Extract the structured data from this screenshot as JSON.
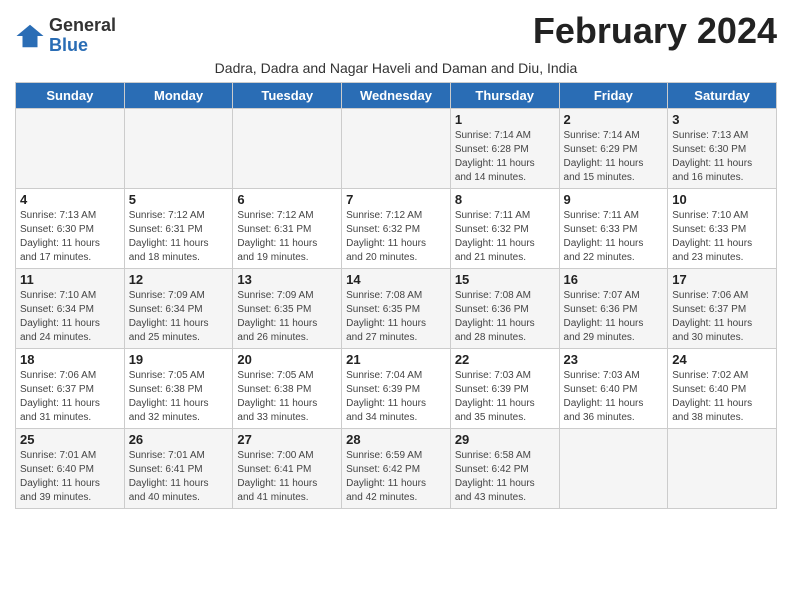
{
  "logo": {
    "general": "General",
    "blue": "Blue"
  },
  "title": "February 2024",
  "subtitle": "Dadra, Dadra and Nagar Haveli and Daman and Diu, India",
  "days_of_week": [
    "Sunday",
    "Monday",
    "Tuesday",
    "Wednesday",
    "Thursday",
    "Friday",
    "Saturday"
  ],
  "weeks": [
    [
      {
        "day": "",
        "info": ""
      },
      {
        "day": "",
        "info": ""
      },
      {
        "day": "",
        "info": ""
      },
      {
        "day": "",
        "info": ""
      },
      {
        "day": "1",
        "info": "Sunrise: 7:14 AM\nSunset: 6:28 PM\nDaylight: 11 hours\nand 14 minutes."
      },
      {
        "day": "2",
        "info": "Sunrise: 7:14 AM\nSunset: 6:29 PM\nDaylight: 11 hours\nand 15 minutes."
      },
      {
        "day": "3",
        "info": "Sunrise: 7:13 AM\nSunset: 6:30 PM\nDaylight: 11 hours\nand 16 minutes."
      }
    ],
    [
      {
        "day": "4",
        "info": "Sunrise: 7:13 AM\nSunset: 6:30 PM\nDaylight: 11 hours\nand 17 minutes."
      },
      {
        "day": "5",
        "info": "Sunrise: 7:12 AM\nSunset: 6:31 PM\nDaylight: 11 hours\nand 18 minutes."
      },
      {
        "day": "6",
        "info": "Sunrise: 7:12 AM\nSunset: 6:31 PM\nDaylight: 11 hours\nand 19 minutes."
      },
      {
        "day": "7",
        "info": "Sunrise: 7:12 AM\nSunset: 6:32 PM\nDaylight: 11 hours\nand 20 minutes."
      },
      {
        "day": "8",
        "info": "Sunrise: 7:11 AM\nSunset: 6:32 PM\nDaylight: 11 hours\nand 21 minutes."
      },
      {
        "day": "9",
        "info": "Sunrise: 7:11 AM\nSunset: 6:33 PM\nDaylight: 11 hours\nand 22 minutes."
      },
      {
        "day": "10",
        "info": "Sunrise: 7:10 AM\nSunset: 6:33 PM\nDaylight: 11 hours\nand 23 minutes."
      }
    ],
    [
      {
        "day": "11",
        "info": "Sunrise: 7:10 AM\nSunset: 6:34 PM\nDaylight: 11 hours\nand 24 minutes."
      },
      {
        "day": "12",
        "info": "Sunrise: 7:09 AM\nSunset: 6:34 PM\nDaylight: 11 hours\nand 25 minutes."
      },
      {
        "day": "13",
        "info": "Sunrise: 7:09 AM\nSunset: 6:35 PM\nDaylight: 11 hours\nand 26 minutes."
      },
      {
        "day": "14",
        "info": "Sunrise: 7:08 AM\nSunset: 6:35 PM\nDaylight: 11 hours\nand 27 minutes."
      },
      {
        "day": "15",
        "info": "Sunrise: 7:08 AM\nSunset: 6:36 PM\nDaylight: 11 hours\nand 28 minutes."
      },
      {
        "day": "16",
        "info": "Sunrise: 7:07 AM\nSunset: 6:36 PM\nDaylight: 11 hours\nand 29 minutes."
      },
      {
        "day": "17",
        "info": "Sunrise: 7:06 AM\nSunset: 6:37 PM\nDaylight: 11 hours\nand 30 minutes."
      }
    ],
    [
      {
        "day": "18",
        "info": "Sunrise: 7:06 AM\nSunset: 6:37 PM\nDaylight: 11 hours\nand 31 minutes."
      },
      {
        "day": "19",
        "info": "Sunrise: 7:05 AM\nSunset: 6:38 PM\nDaylight: 11 hours\nand 32 minutes."
      },
      {
        "day": "20",
        "info": "Sunrise: 7:05 AM\nSunset: 6:38 PM\nDaylight: 11 hours\nand 33 minutes."
      },
      {
        "day": "21",
        "info": "Sunrise: 7:04 AM\nSunset: 6:39 PM\nDaylight: 11 hours\nand 34 minutes."
      },
      {
        "day": "22",
        "info": "Sunrise: 7:03 AM\nSunset: 6:39 PM\nDaylight: 11 hours\nand 35 minutes."
      },
      {
        "day": "23",
        "info": "Sunrise: 7:03 AM\nSunset: 6:40 PM\nDaylight: 11 hours\nand 36 minutes."
      },
      {
        "day": "24",
        "info": "Sunrise: 7:02 AM\nSunset: 6:40 PM\nDaylight: 11 hours\nand 38 minutes."
      }
    ],
    [
      {
        "day": "25",
        "info": "Sunrise: 7:01 AM\nSunset: 6:40 PM\nDaylight: 11 hours\nand 39 minutes."
      },
      {
        "day": "26",
        "info": "Sunrise: 7:01 AM\nSunset: 6:41 PM\nDaylight: 11 hours\nand 40 minutes."
      },
      {
        "day": "27",
        "info": "Sunrise: 7:00 AM\nSunset: 6:41 PM\nDaylight: 11 hours\nand 41 minutes."
      },
      {
        "day": "28",
        "info": "Sunrise: 6:59 AM\nSunset: 6:42 PM\nDaylight: 11 hours\nand 42 minutes."
      },
      {
        "day": "29",
        "info": "Sunrise: 6:58 AM\nSunset: 6:42 PM\nDaylight: 11 hours\nand 43 minutes."
      },
      {
        "day": "",
        "info": ""
      },
      {
        "day": "",
        "info": ""
      }
    ]
  ]
}
